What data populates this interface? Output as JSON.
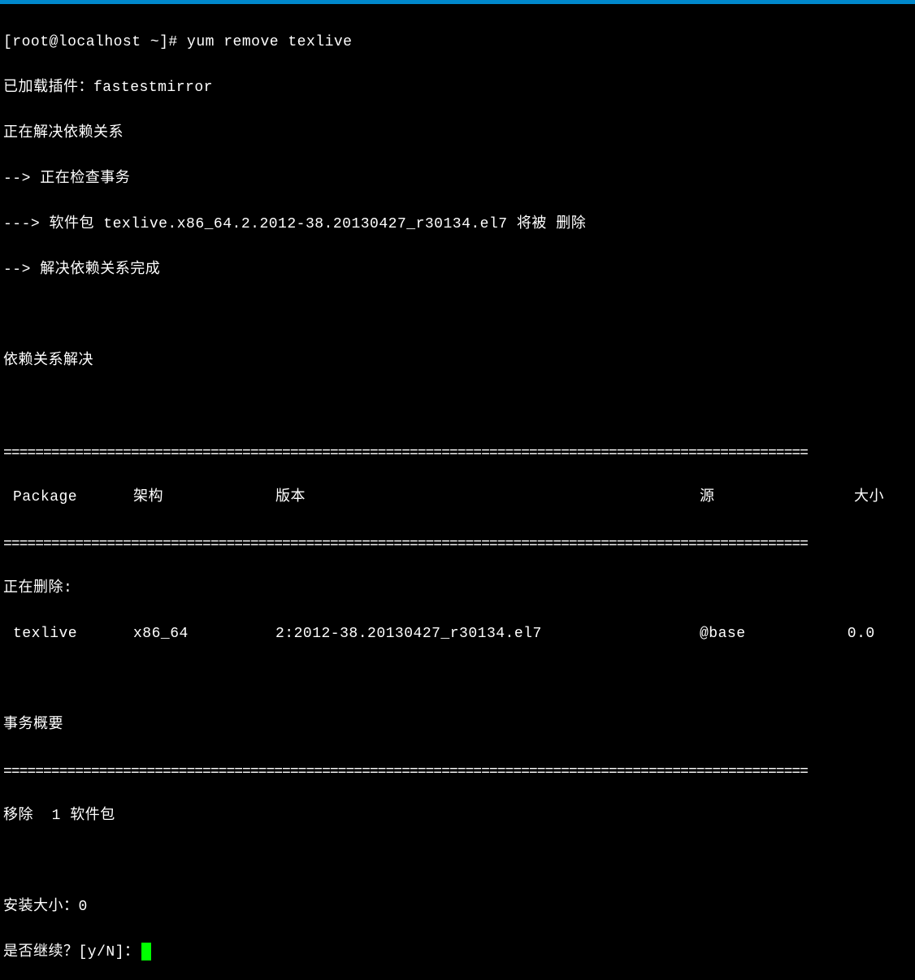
{
  "prompt": "[root@localhost ~]# ",
  "command": "yum remove texlive",
  "lines": [
    "已加载插件：fastestmirror",
    "正在解决依赖关系",
    "--> 正在检查事务",
    "---> 软件包 texlive.x86_64.2.2012-38.20130427_r30134.el7 将被 删除",
    "--> 解决依赖关系完成",
    "",
    "依赖关系解决",
    ""
  ],
  "divider": "=====================================================================================================",
  "header": {
    "package": "Package",
    "arch": "架构",
    "version": "版本",
    "repo": "源",
    "size": "大小"
  },
  "removing_label": "正在删除:",
  "row": {
    "package": "texlive",
    "arch": "x86_64",
    "version": "2:2012-38.20130427_r30134.el7",
    "repo": "@base",
    "size": "0.0 "
  },
  "summary_title": "事务概要",
  "remove_count": "移除  1 软件包",
  "install_size": "安装大小：0",
  "continue_prompt": "是否继续？[y/N]："
}
